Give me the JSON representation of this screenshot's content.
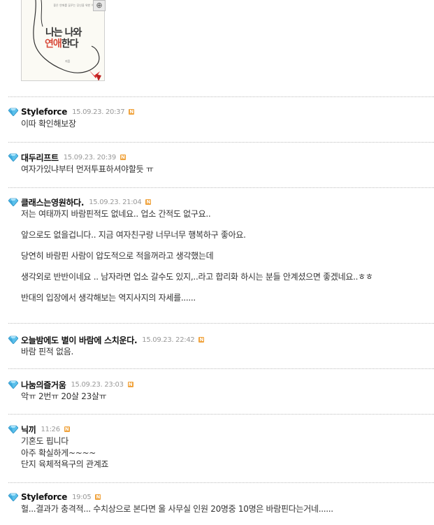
{
  "book": {
    "blurb": "좋은 연애를 꿈꾸는 당신을 위한 이야기",
    "title_line1": "나는 나와",
    "title_line2_accent": "연애",
    "title_line2_rest": "한다",
    "author": "지음",
    "zoom_icon": "zoom-in-icon"
  },
  "new_badge_text": "N",
  "icons": {
    "rank": "diamond-rank-icon"
  },
  "comments": [
    {
      "nick": "Styleforce",
      "time": "15.09.23. 20:37",
      "new": true,
      "lines": [
        "이따 확인해보장"
      ]
    },
    {
      "nick": "대두리프트",
      "time": "15.09.23. 20:39",
      "new": true,
      "lines": [
        "여자가있냐부터 먼저투표하셔야할듯 ㅠ"
      ]
    },
    {
      "nick": "클래스는영원하다.",
      "time": "15.09.23. 21:04",
      "new": true,
      "lines": [
        "저는 여태까지 바람핀적도 없네요.. 업소 간적도 없구요..",
        "",
        "앞으로도 없을겁니다.. 지금 여자친구랑 너무너무 행복하구 좋아요.",
        "",
        "당연히 바람핀 사람이 압도적으로 적을꺼라고 생각했는데",
        "",
        "생각외로 반반이네요 .. 남자라면 업소 갈수도 있지,..라고 합리화 하시는 분들 안계셨으면 좋겠네요..ㅎㅎ",
        "",
        "반대의 입장에서 생각해보는 역지사지의 자세를......"
      ]
    },
    {
      "nick": "오늘밤에도 별이 바람에 스치운다.",
      "time": "15.09.23. 22:42",
      "new": true,
      "lines": [
        "바람 핀적 없음."
      ]
    },
    {
      "nick": "나눔의즐거움",
      "time": "15.09.23. 23:03",
      "new": true,
      "lines": [
        "악ㅠ 2번ㅠ 20살 23살ㅠ"
      ]
    },
    {
      "nick": "닉끼",
      "time": "11:26",
      "new": true,
      "lines": [
        "기혼도 핍니다",
        "아주 확실하게~~~~",
        "단지 육체적욕구의 관계죠"
      ]
    },
    {
      "nick": "Styleforce",
      "time": "19:05",
      "new": true,
      "lines": [
        "헐...결과가 충격적... 수치상으로 본다면 울 사무실 인원 20명중 10명은 바람핀다는거네......"
      ]
    }
  ]
}
